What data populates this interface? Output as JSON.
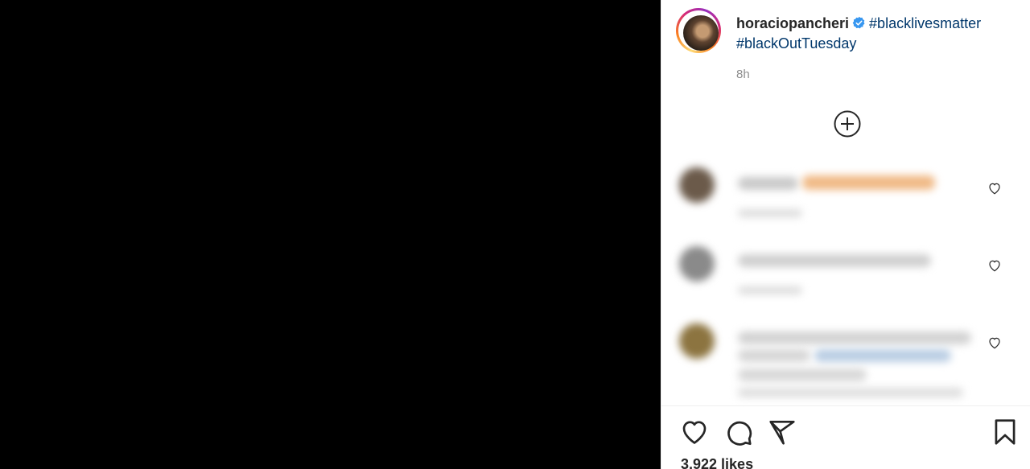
{
  "post": {
    "username": "horaciopancheri",
    "hashtag_1": "#blacklivesmatter",
    "hashtag_2": "#blackOutTuesday",
    "time_ago": "8h",
    "likes": "3,922 likes"
  },
  "icons": {
    "verified": "verified-badge-icon",
    "load_more": "plus-circle-icon",
    "comment_like": "heart-outline-icon",
    "like": "heart-outline-icon",
    "comment": "speech-bubble-icon",
    "share": "paper-plane-icon",
    "save": "bookmark-icon"
  },
  "colors": {
    "media_background": "#000000",
    "verified": "#3897f0",
    "hashtag": "#00376b",
    "muted_text": "#8e8e8e"
  }
}
